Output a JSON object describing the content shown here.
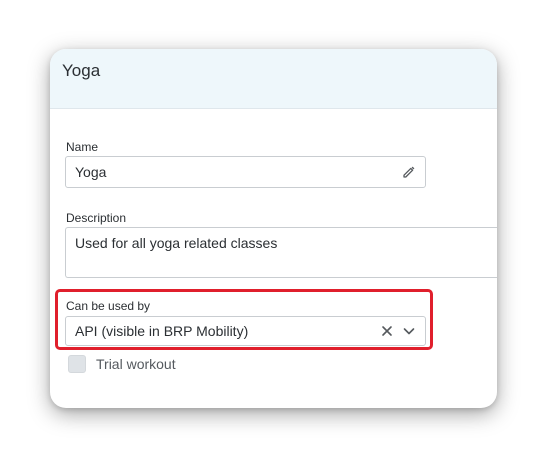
{
  "dialog": {
    "title": "Yoga"
  },
  "form": {
    "name": {
      "label": "Name",
      "value": "Yoga",
      "icon": "pencil-icon"
    },
    "description": {
      "label": "Description",
      "value": "Used for all yoga related classes"
    },
    "usage": {
      "label": "Can be used by",
      "selected_value": "API (visible in BRP Mobility)",
      "clear_icon": "close-icon",
      "dropdown_icon": "chevron-down-icon",
      "highlight_color": "#e01f2c"
    },
    "trial_workout": {
      "label": "Trial workout",
      "checked": false
    }
  },
  "colors": {
    "header_background": "#eef7fb",
    "text": "#2b2f33",
    "border": "#c9cdd1"
  }
}
